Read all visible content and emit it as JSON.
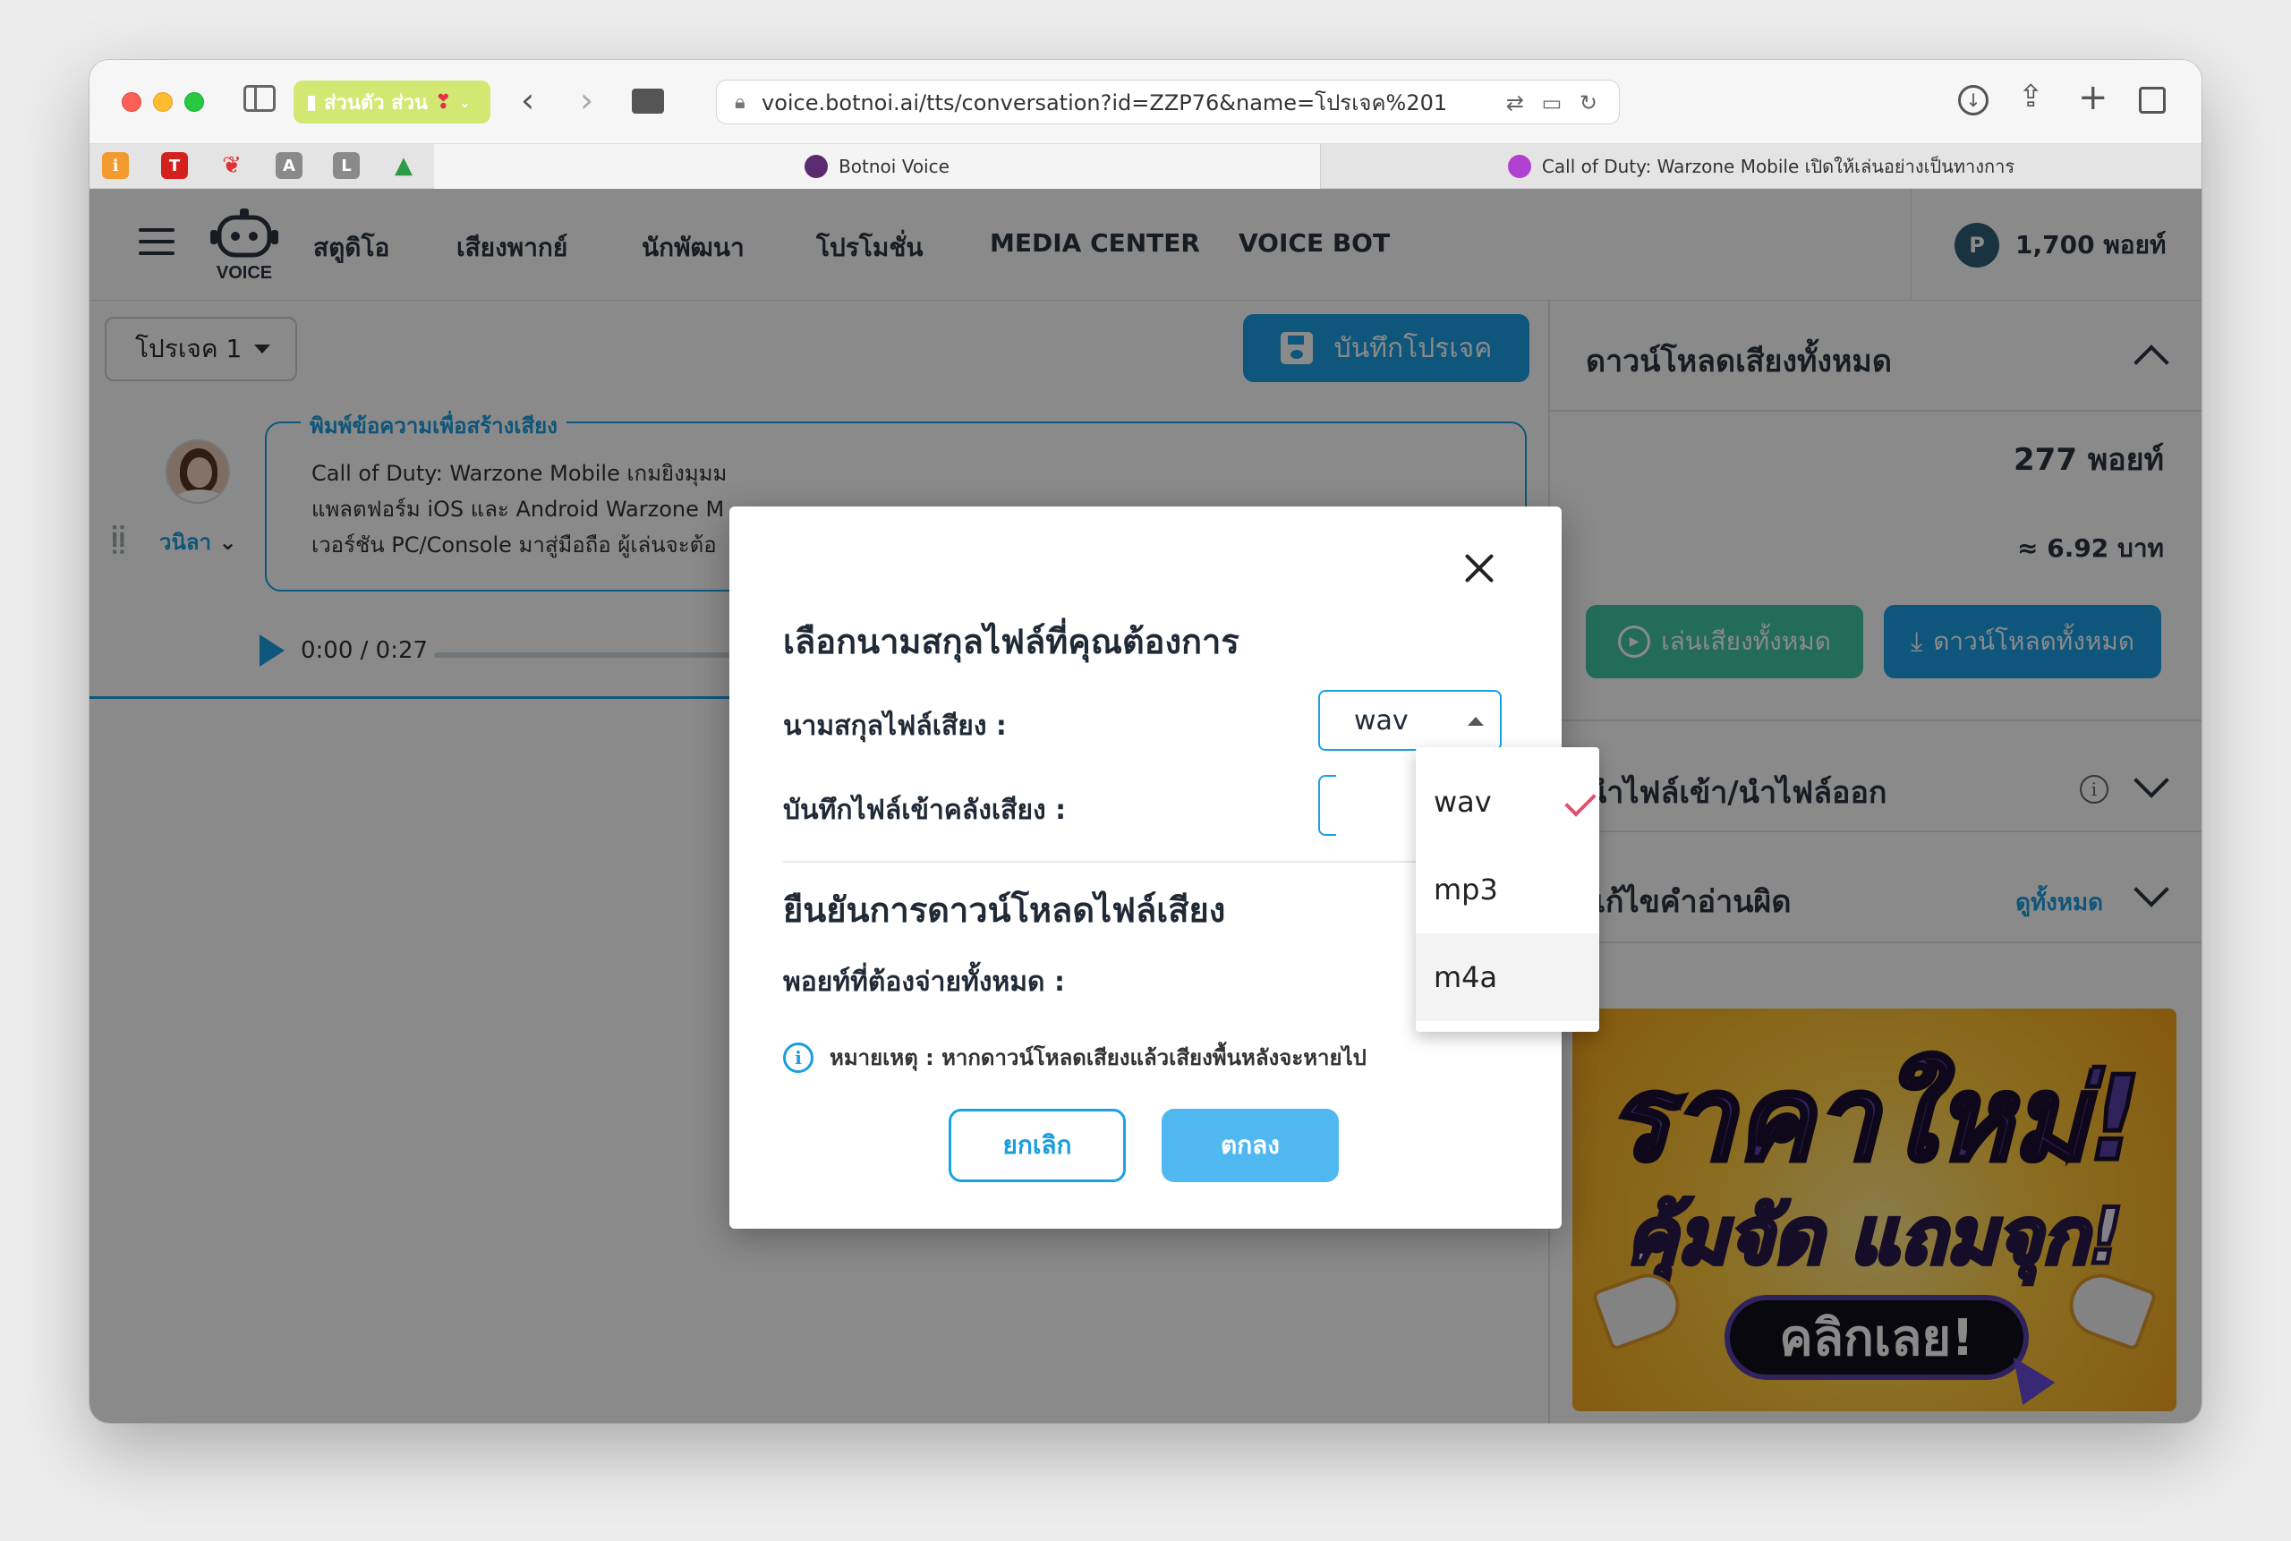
{
  "browser": {
    "profile_label": "ส่วนตัว ส่วน",
    "url": "voice.botnoi.ai/tts/conversation?id=ZZP76&name=โปรเจค%201",
    "tabs": [
      {
        "label": "Botnoi Voice",
        "active": true
      },
      {
        "label": "Call of Duty: Warzone Mobile เปิดให้เล่นอย่างเป็นทางการ",
        "active": false
      }
    ],
    "bookmark_letters": [
      "T",
      "A",
      "L"
    ]
  },
  "nav": {
    "logo_text": "VOICE",
    "items": [
      "สตูดิโอ",
      "เสียงพากย์",
      "นักพัฒนา",
      "โปรโมชั่น",
      "MEDIA CENTER",
      "VOICE BOT"
    ],
    "points_icon": "P",
    "points": "1,700 พอยท์"
  },
  "editor": {
    "project_name": "โปรเจค 1",
    "save_button": "บันทึกโปรเจค",
    "text_label": "พิมพ์ข้อความเพื่อสร้างเสียง",
    "text_lines": [
      "Call of Duty: Warzone Mobile เกมยิงมุมม",
      "แพลตฟอร์ม iOS และ Android Warzone M",
      "เวอร์ชัน PC/Console มาสู่มือถือ ผู้เล่นจะต้อ"
    ],
    "speaker": "วนิลา",
    "player_time": "0:00 / 0:27"
  },
  "right_panel": {
    "download_all_title": "ดาวน์โหลดเสียงทั้งหมด",
    "points": "277 พอยท์",
    "baht": "≈ 6.92 บาท",
    "play_all": "เล่นเสียงทั้งหมด",
    "download_all": "ดาวน์โหลดทั้งหมด",
    "import_export": "นำไฟล์เข้า/นำไฟล์ออก",
    "fix_reading": "แก้ไขคำอ่านผิด",
    "see_all": "ดูทั้งหมด",
    "promo": {
      "line1": "ราคาใหม่!",
      "line2": "คุ้มจัด แถมจุก!",
      "button": "คลิกเลย!"
    }
  },
  "modal": {
    "title": "เลือกนามสกุลไฟล์ที่คุณต้องการ",
    "ext_label": "นามสกุลไฟล์เสียง :",
    "ext_value": "wav",
    "save_to_library_label": "บันทึกไฟล์เข้าคลังเสียง :",
    "confirm_title": "ยืนยันการดาวน์โหลดไฟล์เสียง",
    "points_due_label": "พอยท์ที่ต้องจ่ายทั้งหมด :",
    "note": "หมายเหตุ : หากดาวน์โหลดเสียงแล้วเสียงพื้นหลังจะหายไป",
    "cancel": "ยกเลิก",
    "ok": "ตกลง"
  },
  "dropdown": {
    "options": [
      "wav",
      "mp3",
      "m4a"
    ],
    "selected": "wav",
    "hovered": "m4a"
  },
  "colors": {
    "accent": "#1aa0e6",
    "accent_light": "#4fb8f0",
    "teal": "#41c7a8",
    "check": "#e05070"
  }
}
